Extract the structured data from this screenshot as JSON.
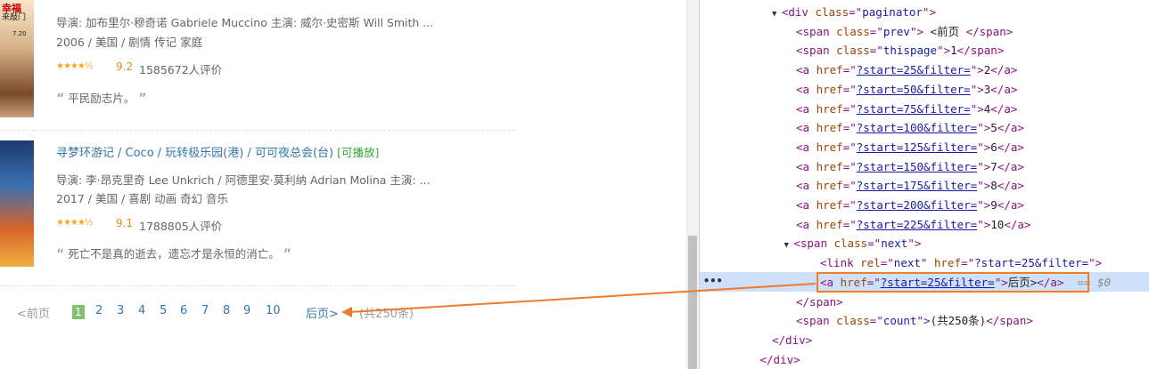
{
  "movies": [
    {
      "poster_text_1": "幸福",
      "poster_text_2": "来敲门",
      "poster_text_3": "7.20",
      "director_line": "导演: 加布里尔·穆奇诺 Gabriele Muccino   主演: 威尔·史密斯 Will Smith ...",
      "meta_line": "2006 / 美国 / 剧情 传记 家庭",
      "stars": "★★★★½",
      "rating": "9.2",
      "votes": "1585672人评价",
      "quote": "平民励志片。",
      "quote_open": "“",
      "quote_close": "”"
    },
    {
      "title": "寻梦环游记",
      "title_other": "/ Coco",
      "title_alt": "/ 玩转极乐园(港) / 可可夜总会(台)",
      "playable": "[可播放]",
      "director_line": "导演: 李·昂克里奇 Lee Unkrich / 阿德里安·莫利纳 Adrian Molina   主演: ...",
      "meta_line": "2017 / 美国 / 喜剧 动画 奇幻 音乐",
      "stars": "★★★★½",
      "rating": "9.1",
      "votes": "1788805人评价",
      "quote": "死亡不是真的逝去，遗忘才是永恒的消亡。",
      "quote_open": "“",
      "quote_close": "”"
    }
  ],
  "paginator": {
    "prev": "<前页",
    "this_page": "1",
    "pages": [
      "2",
      "3",
      "4",
      "5",
      "6",
      "7",
      "8",
      "9",
      "10"
    ],
    "next": "后页>",
    "count": "(共250条)"
  },
  "devtools": {
    "lines": [
      {
        "indent": 6,
        "arrow": "▼",
        "parts": [
          [
            "tag",
            "<div "
          ],
          [
            "attr",
            "class"
          ],
          [
            "tag",
            "=\""
          ],
          [
            "val",
            "paginator"
          ],
          [
            "tag",
            "\">"
          ]
        ]
      },
      {
        "indent": 8,
        "parts": [
          [
            "tag",
            "<span "
          ],
          [
            "attr",
            "class"
          ],
          [
            "tag",
            "=\""
          ],
          [
            "val",
            "prev"
          ],
          [
            "tag",
            "\">"
          ],
          [
            "plain",
            " <前页 "
          ],
          [
            "tag",
            "</span>"
          ]
        ]
      },
      {
        "indent": 8,
        "parts": [
          [
            "tag",
            "<span "
          ],
          [
            "attr",
            "class"
          ],
          [
            "tag",
            "=\""
          ],
          [
            "val",
            "thispage"
          ],
          [
            "tag",
            "\">"
          ],
          [
            "plain",
            "1"
          ],
          [
            "tag",
            "</span>"
          ]
        ]
      },
      {
        "indent": 8,
        "parts": [
          [
            "tag",
            "<a "
          ],
          [
            "attr",
            "href"
          ],
          [
            "tag",
            "=\""
          ],
          [
            "link",
            "?start=25&filter="
          ],
          [
            "tag",
            "\">"
          ],
          [
            "plain",
            "2"
          ],
          [
            "tag",
            "</a>"
          ]
        ]
      },
      {
        "indent": 8,
        "parts": [
          [
            "tag",
            "<a "
          ],
          [
            "attr",
            "href"
          ],
          [
            "tag",
            "=\""
          ],
          [
            "link",
            "?start=50&filter="
          ],
          [
            "tag",
            "\">"
          ],
          [
            "plain",
            "3"
          ],
          [
            "tag",
            "</a>"
          ]
        ]
      },
      {
        "indent": 8,
        "parts": [
          [
            "tag",
            "<a "
          ],
          [
            "attr",
            "href"
          ],
          [
            "tag",
            "=\""
          ],
          [
            "link",
            "?start=75&filter="
          ],
          [
            "tag",
            "\">"
          ],
          [
            "plain",
            "4"
          ],
          [
            "tag",
            "</a>"
          ]
        ]
      },
      {
        "indent": 8,
        "parts": [
          [
            "tag",
            "<a "
          ],
          [
            "attr",
            "href"
          ],
          [
            "tag",
            "=\""
          ],
          [
            "link",
            "?start=100&filter="
          ],
          [
            "tag",
            "\">"
          ],
          [
            "plain",
            "5"
          ],
          [
            "tag",
            "</a>"
          ]
        ]
      },
      {
        "indent": 8,
        "parts": [
          [
            "tag",
            "<a "
          ],
          [
            "attr",
            "href"
          ],
          [
            "tag",
            "=\""
          ],
          [
            "link",
            "?start=125&filter="
          ],
          [
            "tag",
            "\">"
          ],
          [
            "plain",
            "6"
          ],
          [
            "tag",
            "</a>"
          ]
        ]
      },
      {
        "indent": 8,
        "parts": [
          [
            "tag",
            "<a "
          ],
          [
            "attr",
            "href"
          ],
          [
            "tag",
            "=\""
          ],
          [
            "link",
            "?start=150&filter="
          ],
          [
            "tag",
            "\">"
          ],
          [
            "plain",
            "7"
          ],
          [
            "tag",
            "</a>"
          ]
        ]
      },
      {
        "indent": 8,
        "parts": [
          [
            "tag",
            "<a "
          ],
          [
            "attr",
            "href"
          ],
          [
            "tag",
            "=\""
          ],
          [
            "link",
            "?start=175&filter="
          ],
          [
            "tag",
            "\">"
          ],
          [
            "plain",
            "8"
          ],
          [
            "tag",
            "</a>"
          ]
        ]
      },
      {
        "indent": 8,
        "parts": [
          [
            "tag",
            "<a "
          ],
          [
            "attr",
            "href"
          ],
          [
            "tag",
            "=\""
          ],
          [
            "link",
            "?start=200&filter="
          ],
          [
            "tag",
            "\">"
          ],
          [
            "plain",
            "9"
          ],
          [
            "tag",
            "</a>"
          ]
        ]
      },
      {
        "indent": 8,
        "parts": [
          [
            "tag",
            "<a "
          ],
          [
            "attr",
            "href"
          ],
          [
            "tag",
            "=\""
          ],
          [
            "link",
            "?start=225&filter="
          ],
          [
            "tag",
            "\">"
          ],
          [
            "plain",
            "10"
          ],
          [
            "tag",
            "</a>"
          ]
        ]
      },
      {
        "indent": 7,
        "arrow": "▼",
        "parts": [
          [
            "tag",
            "<span "
          ],
          [
            "attr",
            "class"
          ],
          [
            "tag",
            "=\""
          ],
          [
            "val",
            "next"
          ],
          [
            "tag",
            "\">"
          ]
        ]
      },
      {
        "indent": 10,
        "parts": [
          [
            "tag",
            "<link "
          ],
          [
            "attr",
            "rel"
          ],
          [
            "tag",
            "=\""
          ],
          [
            "val",
            "next"
          ],
          [
            "tag",
            "\" "
          ],
          [
            "attr",
            "href"
          ],
          [
            "tag",
            "=\""
          ],
          [
            "val",
            "?start=25&filter="
          ],
          [
            "tag",
            "\">"
          ]
        ]
      },
      {
        "indent": 10,
        "selected": true,
        "parts": [
          [
            "tag",
            "<a "
          ],
          [
            "attr",
            "href"
          ],
          [
            "tag",
            "=\""
          ],
          [
            "link",
            "?start=25&filter="
          ],
          [
            "tag",
            "\">"
          ],
          [
            "plain",
            "后页>"
          ],
          [
            "tag",
            "</a>"
          ]
        ]
      },
      {
        "indent": 8,
        "parts": [
          [
            "tag",
            "</span>"
          ]
        ]
      },
      {
        "indent": 8,
        "parts": [
          [
            "tag",
            "<span "
          ],
          [
            "attr",
            "class"
          ],
          [
            "tag",
            "=\""
          ],
          [
            "val",
            "count"
          ],
          [
            "tag",
            "\">"
          ],
          [
            "plain",
            "(共250条)"
          ],
          [
            "tag",
            "</span>"
          ]
        ]
      },
      {
        "indent": 6,
        "parts": [
          [
            "tag",
            "</div>"
          ]
        ]
      },
      {
        "indent": 5,
        "parts": [
          [
            "tag",
            "</div>"
          ]
        ]
      }
    ],
    "selected_marker": "== $0",
    "dots": "•••"
  },
  "colors": {
    "highlight_box": "#ee7a2a",
    "selection_bg": "#cfe0fb",
    "thispage_bg": "#83bf73"
  }
}
